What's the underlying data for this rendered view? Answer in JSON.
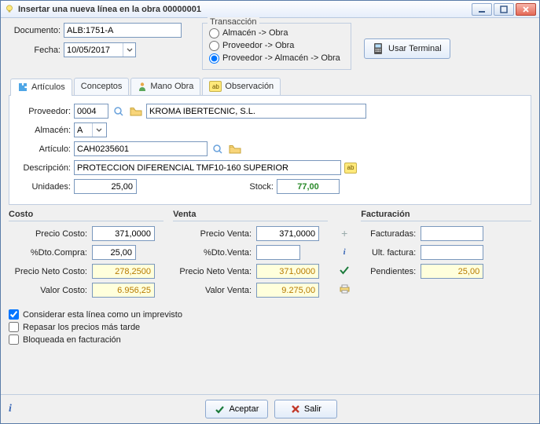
{
  "title": "Insertar una nueva línea en la obra 00000001",
  "documento_label": "Documento:",
  "documento": "ALB:1751-A",
  "fecha_label": "Fecha:",
  "fecha": "10/05/2017",
  "transaccion_label": "Transacción",
  "trans_opts": [
    "Almacén -> Obra",
    "Proveedor -> Obra",
    "Proveedor -> Almacén -> Obra"
  ],
  "usar_terminal": "Usar Terminal",
  "tabs": [
    "Artículos",
    "Conceptos",
    "Mano Obra",
    "Observación"
  ],
  "proveedor_label": "Proveedor:",
  "proveedor_code": "0004",
  "proveedor_name": "KROMA IBERTECNIC, S.L.",
  "almacen_label": "Almacén:",
  "almacen": "A",
  "articulo_label": "Artículo:",
  "articulo": "CAH0235601",
  "descripcion_label": "Descripción:",
  "descripcion": "PROTECCION DIFERENCIAL TMF10-160 SUPERIOR",
  "unidades_label": "Unidades:",
  "unidades": "25,00",
  "stock_label": "Stock:",
  "stock": "77,00",
  "costo": {
    "title": "Costo",
    "precio_costo_label": "Precio Costo:",
    "precio_costo": "371,0000",
    "dto_compra_label": "%Dto.Compra:",
    "dto_compra": "25,00",
    "precio_neto_label": "Precio Neto Costo:",
    "precio_neto": "278,2500",
    "valor_label": "Valor Costo:",
    "valor": "6.956,25"
  },
  "venta": {
    "title": "Venta",
    "precio_venta_label": "Precio Venta:",
    "precio_venta": "371,0000",
    "dto_venta_label": "%Dto.Venta:",
    "dto_venta": "",
    "precio_neto_label": "Precio Neto Venta:",
    "precio_neto": "371,0000",
    "valor_label": "Valor Venta:",
    "valor": "9.275,00"
  },
  "facturacion": {
    "title": "Facturación",
    "facturadas_label": "Facturadas:",
    "facturadas": "",
    "ult_factura_label": "Ult. factura:",
    "ult_factura": "",
    "pendientes_label": "Pendientes:",
    "pendientes": "25,00"
  },
  "chk1": "Considerar esta línea como un imprevisto",
  "chk2": "Repasar los precios más tarde",
  "chk3": "Bloqueada en facturación",
  "aceptar": "Aceptar",
  "salir": "Salir"
}
